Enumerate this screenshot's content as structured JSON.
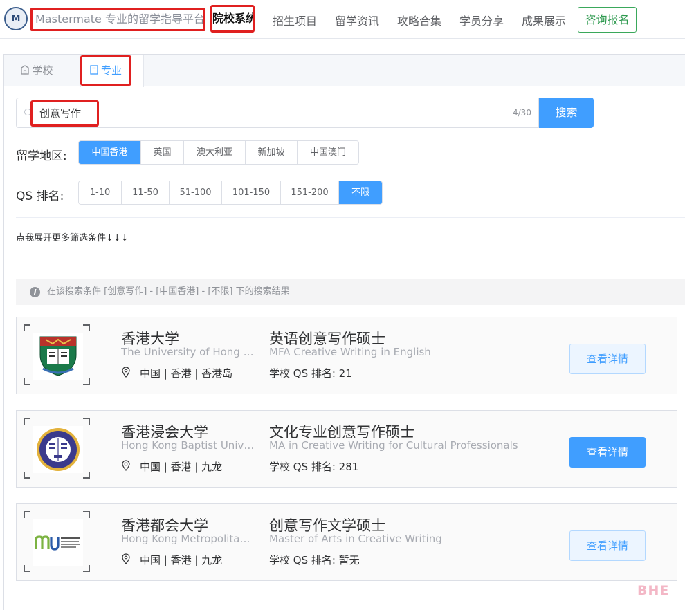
{
  "header": {
    "logo_text": "M",
    "site_title": "Mastermate 专业的留学指导平台",
    "nav_active": "院校系统",
    "nav": [
      "招生项目",
      "留学资讯",
      "攻略合集",
      "学员分享",
      "成果展示"
    ],
    "consult_label": "咨询报名"
  },
  "tabs": {
    "school": "学校",
    "major": "专业"
  },
  "search": {
    "value": "创意写作",
    "count": "4/30",
    "button": "搜索"
  },
  "filters": {
    "region_label": "留学地区:",
    "regions": [
      "中国香港",
      "英国",
      "澳大利亚",
      "新加坡",
      "中国澳门"
    ],
    "region_selected": "中国香港",
    "qs_label": "QS 排名:",
    "qs_ranges": [
      "1-10",
      "11-50",
      "51-100",
      "101-150",
      "151-200",
      "不限"
    ],
    "qs_selected": "不限",
    "expand_text": "点我展开更多筛选条件↓↓↓"
  },
  "result_info": {
    "icon": "info-icon",
    "text": "在该搜索条件 [创意写作] - [中国香港] - [不限] 下的搜索结果"
  },
  "results": [
    {
      "uni_name": "香港大学",
      "uni_en": "The University of Hong Kong",
      "location": "中国 | 香港 | 香港岛",
      "program": "英语创意写作硕士",
      "program_en": "MFA Creative Writing in English",
      "qs": "学校 QS 排名: 21",
      "button": "查看详情",
      "logo": "hku-crest"
    },
    {
      "uni_name": "香港浸会大学",
      "uni_en": "Hong Kong Baptist University",
      "location": "中国 | 香港 | 九龙",
      "program": "文化专业创意写作硕士",
      "program_en": "MA in Creative Writing for Cultural Professionals",
      "qs": "学校 QS 排名: 281",
      "button": "查看详情",
      "logo": "hkbu-seal"
    },
    {
      "uni_name": "香港都会大学",
      "uni_en": "Hong Kong Metropolitan University",
      "location": "中国 | 香港 | 九龙",
      "program": "创意写作文学硕士",
      "program_en": "Master of Arts in Creative Writing",
      "qs": "学校 QS 排名: 暂无",
      "button": "查看详情",
      "logo": "hkmu-logo"
    }
  ],
  "watermark": "BHE",
  "colors": {
    "primary": "#409eff",
    "highlight_box": "#e02020",
    "consult_green": "#2f9a50"
  }
}
